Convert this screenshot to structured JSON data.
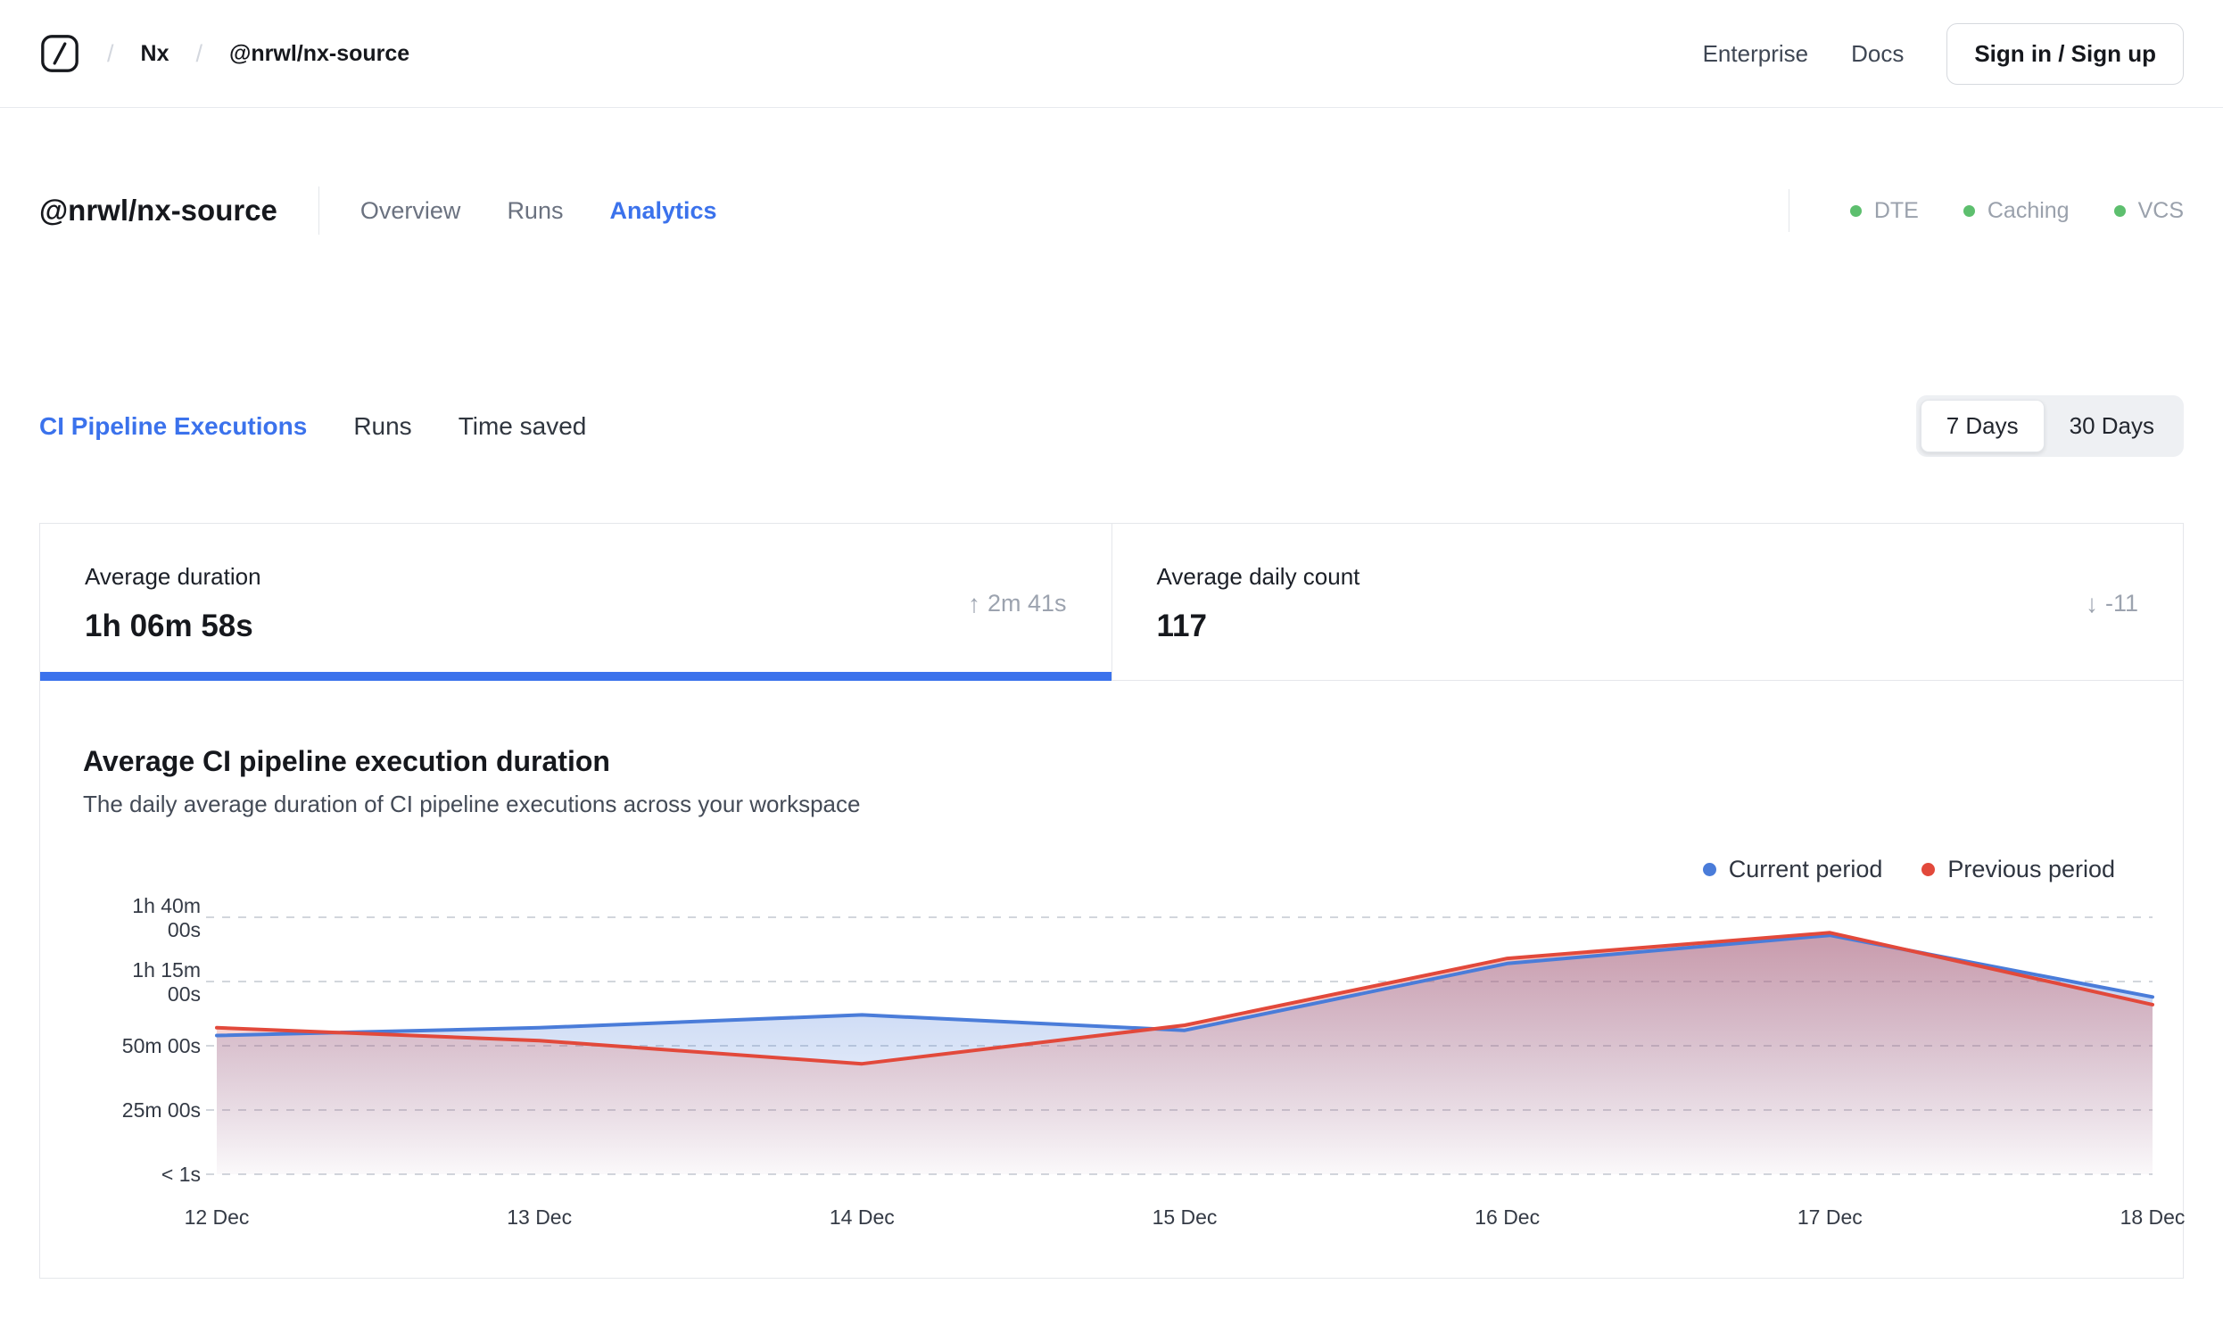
{
  "navbar": {
    "breadcrumb": {
      "separator": "/",
      "items": [
        {
          "label": "Nx"
        },
        {
          "label": "@nrwl/nx-source"
        }
      ]
    },
    "enterprise_link": "Enterprise",
    "docs_link": "Docs",
    "signin_button": "Sign in / Sign up"
  },
  "header": {
    "title": "@nrwl/nx-source",
    "tabs": [
      {
        "label": "Overview",
        "active": false
      },
      {
        "label": "Runs",
        "active": false
      },
      {
        "label": "Analytics",
        "active": true
      }
    ],
    "status_badges": [
      {
        "label": "DTE",
        "color": "#5dbf6e"
      },
      {
        "label": "Caching",
        "color": "#5dbf6e"
      },
      {
        "label": "VCS",
        "color": "#5dbf6e"
      }
    ]
  },
  "section": {
    "tabs": [
      {
        "label": "CI Pipeline Executions",
        "active": true
      },
      {
        "label": "Runs",
        "active": false
      },
      {
        "label": "Time saved",
        "active": false
      }
    ],
    "range_toggle": {
      "options": [
        {
          "label": "7 Days",
          "active": true
        },
        {
          "label": "30 Days",
          "active": false
        }
      ]
    }
  },
  "stats": [
    {
      "label": "Average duration",
      "value": "1h 06m 58s",
      "arrow": "↑",
      "delta": "2m 41s",
      "delta_direction": "up",
      "active": true
    },
    {
      "label": "Average daily count",
      "value": "117",
      "arrow": "↓",
      "delta": "-11",
      "delta_direction": "down",
      "active": false
    }
  ],
  "chart": {
    "title": "Average CI pipeline execution duration",
    "subtitle": "The daily average duration of CI pipeline executions across your workspace",
    "legend": [
      {
        "label": "Current period",
        "color": "#4a7cd9"
      },
      {
        "label": "Previous period",
        "color": "#e2493b"
      }
    ]
  },
  "chart_data": {
    "type": "line",
    "title": "Average CI pipeline execution duration",
    "x": [
      "12 Dec",
      "13 Dec",
      "14 Dec",
      "15 Dec",
      "16 Dec",
      "17 Dec",
      "18 Dec"
    ],
    "y_unit": "minutes",
    "ylim": [
      0,
      100
    ],
    "y_ticks": [
      {
        "value": 100,
        "label": "1h 40m 00s",
        "lines": [
          "1h 40m",
          "00s"
        ]
      },
      {
        "value": 75,
        "label": "1h 15m 00s",
        "lines": [
          "1h 15m",
          "00s"
        ]
      },
      {
        "value": 50,
        "label": "50m 00s",
        "lines": [
          "50m 00s"
        ]
      },
      {
        "value": 25,
        "label": "25m 00s",
        "lines": [
          "25m 00s"
        ]
      },
      {
        "value": 0,
        "label": "< 1s",
        "lines": [
          "< 1s"
        ]
      }
    ],
    "grid": "dashed-horizontal",
    "legend_position": "top-right",
    "series": [
      {
        "name": "Current period",
        "color": "#4a7cd9",
        "fill": "gradient",
        "values": [
          54,
          57,
          62,
          56,
          82,
          93,
          69
        ]
      },
      {
        "name": "Previous period",
        "color": "#e2493b",
        "fill": "gradient",
        "values": [
          57,
          52,
          43,
          58,
          84,
          94,
          66
        ]
      }
    ]
  },
  "colors": {
    "accent_blue": "#3b72ec",
    "badge_green": "#5dbf6e",
    "border_gray": "#e5e7eb",
    "muted_text": "#9ca3af"
  }
}
